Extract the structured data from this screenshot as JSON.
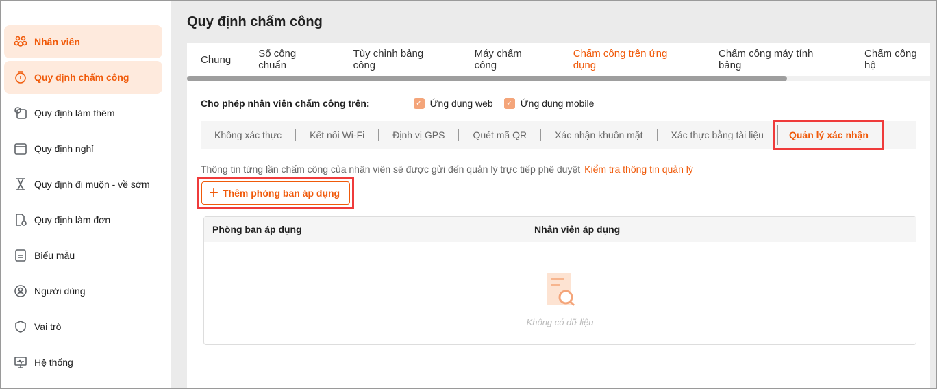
{
  "sidebar": {
    "items": [
      {
        "label": "Nhân viên",
        "icon": "users-icon"
      },
      {
        "label": "Quy định chấm công",
        "icon": "stopwatch-icon"
      },
      {
        "label": "Quy định làm thêm",
        "icon": "clock-calendar-icon"
      },
      {
        "label": "Quy định nghỉ",
        "icon": "calendar-icon"
      },
      {
        "label": "Quy định đi muộn - về sớm",
        "icon": "hourglass-icon"
      },
      {
        "label": "Quy định làm đơn",
        "icon": "document-clock-icon"
      },
      {
        "label": "Biểu mẫu",
        "icon": "form-icon"
      },
      {
        "label": "Người dùng",
        "icon": "user-circle-icon"
      },
      {
        "label": "Vai trò",
        "icon": "shield-icon"
      },
      {
        "label": "Hệ thống",
        "icon": "monitor-icon"
      }
    ]
  },
  "page": {
    "title": "Quy định chấm công"
  },
  "tabs": [
    "Chung",
    "Số công chuẩn",
    "Tùy chỉnh bảng công",
    "Máy chấm công",
    "Chấm công trên ứng dụng",
    "Chấm công máy tính bảng",
    "Chấm công hộ"
  ],
  "allow": {
    "label": "Cho phép nhân viên chấm công trên:",
    "options": [
      "Ứng dụng web",
      "Ứng dụng mobile"
    ]
  },
  "subtabs": [
    "Không xác thực",
    "Kết nối Wi-Fi",
    "Định vị GPS",
    "Quét mã QR",
    "Xác nhận khuôn mặt",
    "Xác thực bằng tài liệu",
    "Quản lý xác nhận"
  ],
  "info": {
    "text": "Thông tin từng lần chấm công của nhân viên sẽ được gửi đến quản lý trực tiếp phê duyệt",
    "link": "Kiểm tra thông tin quản lý"
  },
  "add_button": "Thêm phòng ban áp dụng",
  "table": {
    "columns": [
      "Phòng ban áp dụng",
      "Nhân viên áp dụng"
    ],
    "empty": "Không có dữ liệu"
  },
  "colors": {
    "accent": "#f05a0a",
    "highlight": "#ef3b3b"
  }
}
